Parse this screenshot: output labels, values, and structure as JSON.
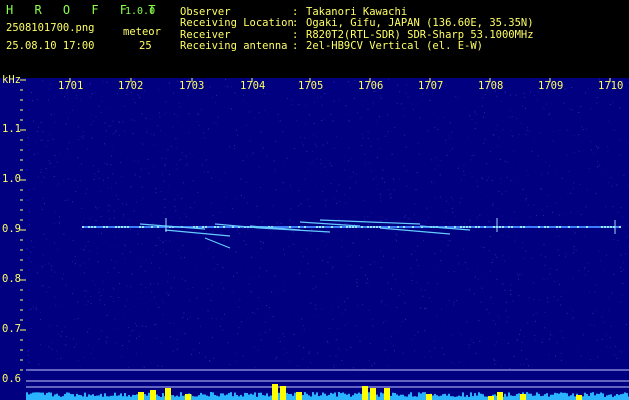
{
  "app": {
    "name": "H R O F F T",
    "version": "1.0.0"
  },
  "file": {
    "name": "2508101700.png",
    "datetime": "25.08.10 17:00"
  },
  "counter": {
    "label": "meteor",
    "value": "25"
  },
  "info": [
    {
      "key": "Observer",
      "sep": ":",
      "value": "Takanori Kawachi"
    },
    {
      "key": "Receiving Location",
      "sep": ":",
      "value": "Ogaki, Gifu, JAPAN (136.60E, 35.35N)"
    },
    {
      "key": "Receiver",
      "sep": ":",
      "value": "R820T2(RTL-SDR) SDR-Sharp 53.1000MHz"
    },
    {
      "key": "Receiving antenna",
      "sep": ":",
      "value": "2el-HB9CV Vertical (el. E-W)"
    }
  ],
  "axis": {
    "y_unit": "kHz",
    "x_ticks": [
      "1701",
      "1702",
      "1703",
      "1704",
      "1705",
      "1706",
      "1707",
      "1708",
      "1709",
      "1710"
    ],
    "y_ticks": [
      "1.1",
      "1.0",
      "0.9",
      "0.8",
      "0.7",
      "0.6"
    ]
  },
  "colors": {
    "background": "#000080",
    "header_text": "#ffff66",
    "title_text": "#8cff4a",
    "signal": "#66ccff",
    "activity_bar": "#ffff00"
  }
}
